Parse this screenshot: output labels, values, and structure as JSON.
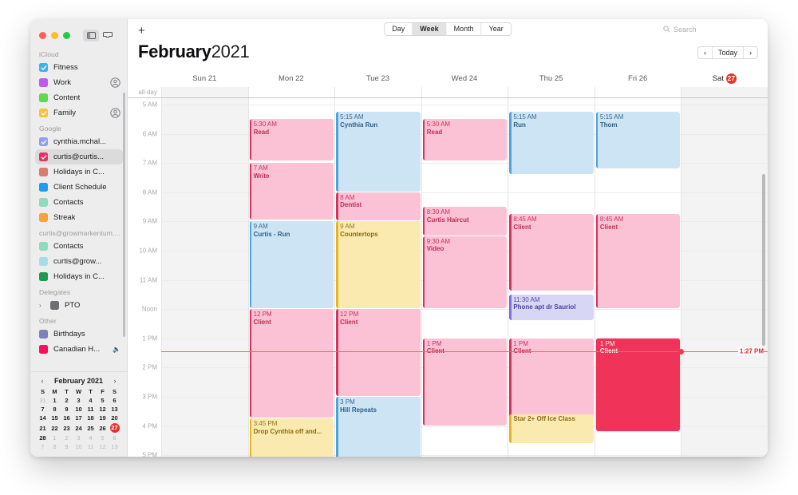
{
  "window": {
    "traffic_lights": [
      "close",
      "minimize",
      "zoom"
    ],
    "segmented": [
      {
        "name": "calendar-view-toggle",
        "active": true
      },
      {
        "name": "inbox-toggle",
        "active": false
      }
    ]
  },
  "toolbar": {
    "add_label": "+",
    "views": [
      {
        "label": "Day",
        "active": false
      },
      {
        "label": "Week",
        "active": true
      },
      {
        "label": "Month",
        "active": false
      },
      {
        "label": "Year",
        "active": false
      }
    ],
    "search_placeholder": "Search"
  },
  "header": {
    "month": "February",
    "year": "2021",
    "prev_label": "‹",
    "today_label": "Today",
    "next_label": "›"
  },
  "sidebar": {
    "groups": [
      {
        "title": "iCloud",
        "items": [
          {
            "label": "Fitness",
            "color": "#3ab3ef",
            "checked": true,
            "shared": false
          },
          {
            "label": "Work",
            "color": "#c358ec",
            "checked": false,
            "shared": true
          },
          {
            "label": "Content",
            "color": "#5ed94b",
            "checked": false,
            "shared": false
          },
          {
            "label": "Family",
            "color": "#f5c53b",
            "checked": true,
            "shared": true
          }
        ]
      },
      {
        "title": "Google",
        "items": [
          {
            "label": "cynthia.mchal...",
            "color": "#8f9ef0",
            "checked": true,
            "shared": false
          },
          {
            "label": "curtis@curtis...",
            "color": "#ef2d63",
            "checked": true,
            "shared": false,
            "selected": true
          },
          {
            "label": "Holidays in C...",
            "color": "#dd7a72",
            "checked": false,
            "shared": false
          },
          {
            "label": "Client Schedule",
            "color": "#1a9ff0",
            "checked": false,
            "shared": false
          },
          {
            "label": "Contacts",
            "color": "#8edcbd",
            "checked": false,
            "shared": false
          },
          {
            "label": "Streak",
            "color": "#f5a33b",
            "checked": false,
            "shared": false
          }
        ]
      },
      {
        "title": "curtis@growmarkentum....",
        "items": [
          {
            "label": "Contacts",
            "color": "#8edcbd",
            "checked": false,
            "shared": false
          },
          {
            "label": "curtis@grow...",
            "color": "#a8dced",
            "checked": false,
            "shared": false
          },
          {
            "label": "Holidays in C...",
            "color": "#1e9b4e",
            "checked": false,
            "shared": false
          }
        ]
      },
      {
        "title": "Delegates",
        "items": [
          {
            "label": "PTO",
            "color": "#6e6e73",
            "checked": false,
            "shared": false,
            "disclosure": "›"
          }
        ]
      },
      {
        "title": "Other",
        "items": [
          {
            "label": "Birthdays",
            "color": "#7b83b8",
            "checked": false,
            "shared": false
          },
          {
            "label": "Canadian H...",
            "color": "#f3145c",
            "checked": false,
            "shared": false,
            "muted": true
          }
        ]
      }
    ]
  },
  "mini_calendar": {
    "title": "February 2021",
    "prev": "‹",
    "next": "›",
    "weekday_headers": [
      "S",
      "M",
      "T",
      "W",
      "T",
      "F",
      "S"
    ],
    "today": 27,
    "weeks": [
      [
        {
          "d": 31,
          "muted": true
        },
        {
          "d": 1
        },
        {
          "d": 2
        },
        {
          "d": 3
        },
        {
          "d": 4
        },
        {
          "d": 5
        },
        {
          "d": 6
        }
      ],
      [
        {
          "d": 7
        },
        {
          "d": 8
        },
        {
          "d": 9
        },
        {
          "d": 10
        },
        {
          "d": 11
        },
        {
          "d": 12
        },
        {
          "d": 13
        }
      ],
      [
        {
          "d": 14
        },
        {
          "d": 15
        },
        {
          "d": 16
        },
        {
          "d": 17
        },
        {
          "d": 18
        },
        {
          "d": 19
        },
        {
          "d": 20
        }
      ],
      [
        {
          "d": 21
        },
        {
          "d": 22
        },
        {
          "d": 23
        },
        {
          "d": 24
        },
        {
          "d": 25
        },
        {
          "d": 26
        },
        {
          "d": 27,
          "today": true
        }
      ],
      [
        {
          "d": 28
        },
        {
          "d": 1,
          "muted": true
        },
        {
          "d": 2,
          "muted": true
        },
        {
          "d": 3,
          "muted": true
        },
        {
          "d": 4,
          "muted": true
        },
        {
          "d": 5,
          "muted": true
        },
        {
          "d": 6,
          "muted": true
        }
      ],
      [
        {
          "d": 7,
          "muted": true
        },
        {
          "d": 8,
          "muted": true
        },
        {
          "d": 9,
          "muted": true
        },
        {
          "d": 10,
          "muted": true
        },
        {
          "d": 11,
          "muted": true
        },
        {
          "d": 12,
          "muted": true
        },
        {
          "d": 13,
          "muted": true
        }
      ]
    ]
  },
  "calendar_grid": {
    "all_day_label": "all-day",
    "days": [
      {
        "label": "Sun 21",
        "weekend": true,
        "today": false
      },
      {
        "label": "Mon 22",
        "weekend": false,
        "today": false
      },
      {
        "label": "Tue 23",
        "weekend": false,
        "today": false
      },
      {
        "label": "Wed 24",
        "weekend": false,
        "today": false
      },
      {
        "label": "Thu 25",
        "weekend": false,
        "today": false
      },
      {
        "label": "Fri 26",
        "weekend": false,
        "today": false
      },
      {
        "label": "Sat",
        "day_number": "27",
        "weekend": true,
        "today": true
      }
    ],
    "hour_labels": [
      "5 AM",
      "6 AM",
      "7 AM",
      "8 AM",
      "9 AM",
      "10 AM",
      "11 AM",
      "Noon",
      "1 PM",
      "2 PM",
      "3 PM",
      "4 PM",
      "5 PM"
    ],
    "now_label": "1:27 PM",
    "now_hour": 13.45,
    "events": [
      {
        "day": 1,
        "time": "5:30 AM",
        "title": "Read",
        "start": 5.5,
        "end": 6.95,
        "bg": "#fac2d4",
        "bar": "#d8315f",
        "text": "#c52a52"
      },
      {
        "day": 1,
        "time": "7 AM",
        "title": "Write",
        "start": 7.0,
        "end": 8.95,
        "bg": "#fac2d4",
        "bar": "#d8315f",
        "text": "#c52a52"
      },
      {
        "day": 1,
        "time": "9 AM",
        "title": "Curtis - Run",
        "start": 9.0,
        "end": 12.0,
        "bg": "#cde4f5",
        "bar": "#4da3dd",
        "text": "#2e5f86"
      },
      {
        "day": 1,
        "time": "12 PM",
        "title": "Client",
        "start": 12.0,
        "end": 15.75,
        "bg": "#fac2d4",
        "bar": "#d8315f",
        "text": "#c52a52"
      },
      {
        "day": 1,
        "time": "3:45 PM",
        "title": "Drop Cynthia off and...",
        "start": 15.75,
        "end": 17.2,
        "bg": "#fbeab0",
        "bar": "#e7b325",
        "text": "#8a6a13"
      },
      {
        "day": 2,
        "time": "5:15 AM",
        "title": "Cynthia Run",
        "start": 5.25,
        "end": 8.0,
        "bg": "#cde4f5",
        "bar": "#4da3dd",
        "text": "#2e5f86"
      },
      {
        "day": 2,
        "time": "8 AM",
        "title": "Dentist",
        "start": 8.0,
        "end": 9.0,
        "bg": "#fac2d4",
        "bar": "#d8315f",
        "text": "#c52a52"
      },
      {
        "day": 2,
        "time": "9 AM",
        "title": "Countertops",
        "start": 9.0,
        "end": 12.0,
        "bg": "#fbeab0",
        "bar": "#e7b325",
        "text": "#8a6a13"
      },
      {
        "day": 2,
        "time": "12 PM",
        "title": "Client",
        "start": 12.0,
        "end": 15.0,
        "bg": "#fac2d4",
        "bar": "#d8315f",
        "text": "#c52a52"
      },
      {
        "day": 2,
        "time": "3 PM",
        "title": "Hill Repeats",
        "start": 15.0,
        "end": 17.2,
        "bg": "#cde4f5",
        "bar": "#4da3dd",
        "text": "#2e5f86"
      },
      {
        "day": 3,
        "time": "5:30 AM",
        "title": "Read",
        "start": 5.5,
        "end": 6.95,
        "bg": "#fac2d4",
        "bar": "#d8315f",
        "text": "#c52a52"
      },
      {
        "day": 3,
        "time": "8:30 AM",
        "title": "Curtis Haircut",
        "start": 8.5,
        "end": 9.5,
        "bg": "#fac2d4",
        "bar": "#d8315f",
        "text": "#c52a52"
      },
      {
        "day": 3,
        "time": "9:30 AM",
        "title": "Video",
        "start": 9.5,
        "end": 12.0,
        "bg": "#fac2d4",
        "bar": "#d8315f",
        "text": "#c52a52"
      },
      {
        "day": 3,
        "time": "1 PM",
        "title": "Client",
        "start": 13.0,
        "end": 16.0,
        "bg": "#fac2d4",
        "bar": "#d8315f",
        "text": "#c52a52"
      },
      {
        "day": 4,
        "time": "5:15 AM",
        "title": "Run",
        "start": 5.25,
        "end": 7.4,
        "bg": "#cde4f5",
        "bar": "#4da3dd",
        "text": "#2e5f86"
      },
      {
        "day": 4,
        "time": "8:45 AM",
        "title": "Client",
        "start": 8.75,
        "end": 11.4,
        "bg": "#fac2d4",
        "bar": "#d8315f",
        "text": "#c52a52"
      },
      {
        "day": 4,
        "time": "11:30 AM",
        "title": "Phone apt dr Sauriol",
        "start": 11.5,
        "end": 12.4,
        "bg": "#d7d6f5",
        "bar": "#7b6ee0",
        "text": "#4a3fa0"
      },
      {
        "day": 4,
        "time": "1 PM",
        "title": "Client",
        "start": 13.0,
        "end": 16.2,
        "bg": "#fac2d4",
        "bar": "#d8315f",
        "text": "#c52a52"
      },
      {
        "day": 4,
        "time": "",
        "title": "Star 2+ Off Ice Class",
        "start": 15.6,
        "end": 16.6,
        "bg": "#fbeab0",
        "bar": "#e7b325",
        "text": "#8a6a13"
      },
      {
        "day": 5,
        "time": "5:15 AM",
        "title": "Thom",
        "start": 5.25,
        "end": 7.2,
        "bg": "#cde4f5",
        "bar": "#4da3dd",
        "text": "#2e5f86"
      },
      {
        "day": 5,
        "time": "8:45 AM",
        "title": "Client",
        "start": 8.75,
        "end": 12.0,
        "bg": "#fac2d4",
        "bar": "#d8315f",
        "text": "#c52a52"
      },
      {
        "day": 5,
        "time": "1 PM",
        "title": "Client",
        "start": 13.0,
        "end": 16.2,
        "bg": "#ef3359",
        "bar": "#ef3359",
        "text": "#ffffff",
        "selected": true
      }
    ]
  }
}
